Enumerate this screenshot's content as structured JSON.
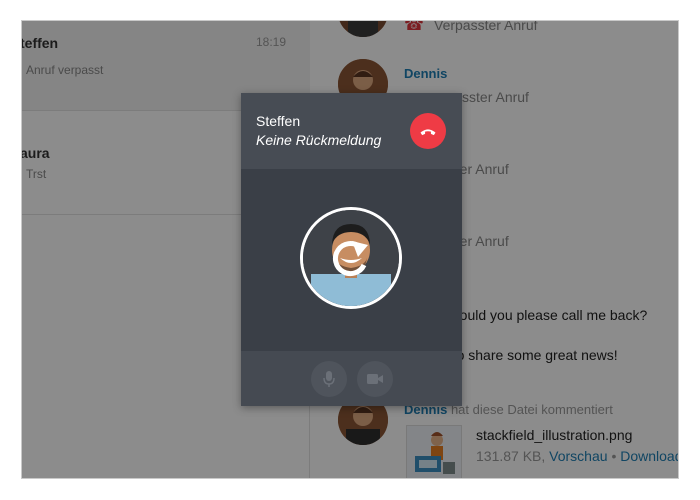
{
  "conversations": [
    {
      "name": "teffen",
      "time": "18:19",
      "subtitle": "Anruf verpasst"
    },
    {
      "name": "aura",
      "subtitle": "Trst"
    }
  ],
  "chat": {
    "missed_call_text_1": "Verpasster Anruf",
    "author_1": "Dennis",
    "missed_call_text_2": "erpasster Anruf",
    "missed_call_text_3": "asster Anruf",
    "missed_call_text_4": "asster Anruf",
    "message_1": "n! Could you please call me back?",
    "message_2": "ke to share some great news!",
    "comment_author": "Dennis",
    "comment_action": " hat diese Datei kommentiert",
    "file_name": "stackfield_illustration.png",
    "file_size": "131.87 KB,",
    "file_preview_link": "Vorschau",
    "file_separator": "•",
    "file_download_link": "Download"
  },
  "call": {
    "name": "Steffen",
    "status": "Keine Rückmeldung"
  },
  "colors": {
    "accent_blue": "#1e7fb4",
    "hangup_red": "#ef3b45",
    "dialog_bg": "#3a3f47"
  },
  "icons": [
    "phone-missed-icon",
    "hangup-icon",
    "refresh-icon",
    "microphone-icon",
    "video-camera-icon"
  ]
}
